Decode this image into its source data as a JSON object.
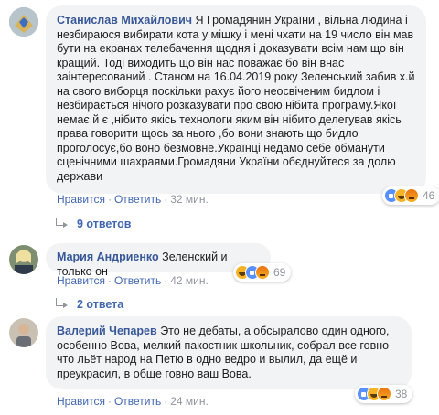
{
  "colors": {
    "author": "#385898",
    "action": "#4267b2",
    "meta": "#90949c",
    "bubble": "#f2f3f5"
  },
  "comments": [
    {
      "author": "Станислав Михайлович",
      "text": "Я Громадянин України , вільна людина і незбираюся вибирати кота у мішку і мені чхати на 19 число він мав бути на екранах телебачення щодня і доказувати всім нам що він кращий. Тоді виходить що він нас поважає бо він внас заінтересований . Станом на 16.04.2019 року Зеленський забив х.й на свого виборця поскільки рахує його неосвіченим бидлом і незбирається нічого розказувати про свою нібита програму.Якої немає й є ,нібито якісь технологи яким він нібито делегував якісь права говорити щось за нього ,бо вони знають що бидло проголосує,бо воно безмовне.Українці недамо себе обманути сценічними шахраями.Громадяни України обєднуйтеся за долю держави",
      "like": "Нравится",
      "reply": "Ответить",
      "time": "32 мин.",
      "reactions": [
        "like-icon",
        "haha-icon",
        "angry-icon"
      ],
      "reaction_count": "46",
      "replies_label": "9 ответов"
    },
    {
      "author": "Мария Андриенко",
      "text": "Зеленский и только он",
      "like": "Нравится",
      "reply": "Ответить",
      "time": "42 мин.",
      "reactions": [
        "haha-icon",
        "like-icon",
        "angry-icon"
      ],
      "reaction_count": "69",
      "replies_label": "2 ответа"
    },
    {
      "author": "Валерий Чепарев",
      "text": "Это не дебаты, а обсыралово один одного, особенно Вова, мелкий пакостник школьник, собрал все говно что льёт народ на Петю в одно ведро и вылил, да ещё и преукрасил, в обще говно ваш Вова.",
      "like": "Нравится",
      "reply": "Ответить",
      "time": "24 мин.",
      "reactions": [
        "like-icon",
        "haha-icon",
        "angry-icon"
      ],
      "reaction_count": "38"
    }
  ]
}
